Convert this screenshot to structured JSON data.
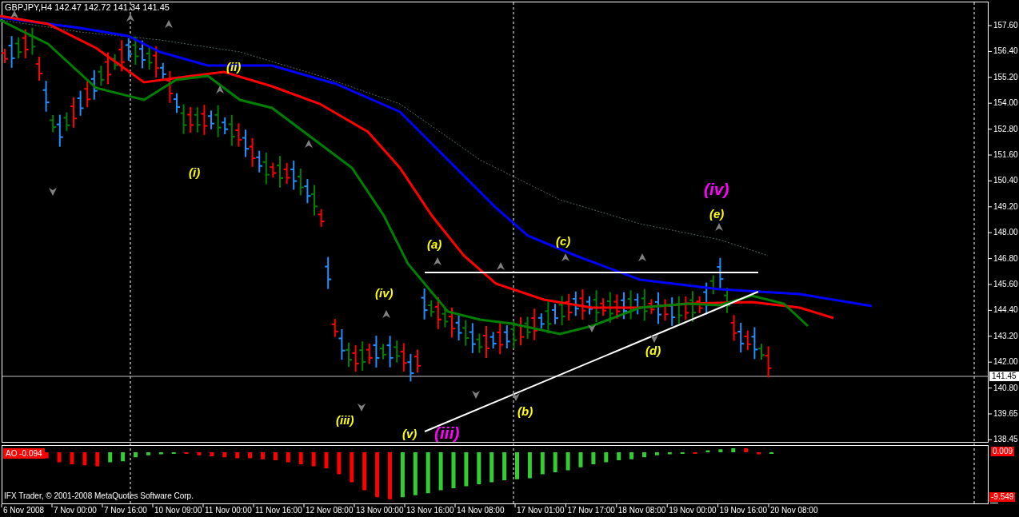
{
  "header": "GBPJPY,H4  142.47 142.72 141.34 141.45",
  "price_axis": [
    "157.60",
    "156.40",
    "155.20",
    "154.00",
    "152.80",
    "151.60",
    "150.40",
    "149.20",
    "148.00",
    "146.80",
    "145.60",
    "144.40",
    "143.20",
    "142.00",
    "140.80",
    "139.65",
    "138.45"
  ],
  "current_price": "141.45",
  "wave_labels": [
    {
      "text": "(i)",
      "color": "#ffff00"
    },
    {
      "text": "(ii)",
      "color": "#ffff00"
    },
    {
      "text": "(iii)",
      "color": "#ffff00"
    },
    {
      "text": "(iv)",
      "color": "#ffff00"
    },
    {
      "text": "(v)",
      "color": "#ffff00"
    },
    {
      "text": "(iii)",
      "color": "#ff00ff"
    },
    {
      "text": "(a)",
      "color": "#ffff00"
    },
    {
      "text": "(b)",
      "color": "#ffff00"
    },
    {
      "text": "(c)",
      "color": "#ffff00"
    },
    {
      "text": "(d)",
      "color": "#ffff00"
    },
    {
      "text": "(e)",
      "color": "#ffff00"
    },
    {
      "text": "(iv)",
      "color": "#ff00ff"
    }
  ],
  "indicator": {
    "label": "AO -0.094",
    "max": "0.009",
    "min": "-9.549"
  },
  "copyright": "IFX Trader, © 2001-2008 MetaQuotes Software Corp.",
  "time_axis": [
    "6 Nov 2008",
    "7 Nov 00:00",
    "7 Nov 16:00",
    "10 Nov 09:00",
    "11 Nov 00:00",
    "11 Nov 16:00",
    "12 Nov 08:00",
    "13 Nov 00:00",
    "13 Nov 16:00",
    "14 Nov 08:00",
    "17 Nov 01:00",
    "17 Nov 17:00",
    "18 Nov 08:00",
    "19 Nov 00:00",
    "19 Nov 16:00",
    "20 Nov 08:00"
  ]
}
